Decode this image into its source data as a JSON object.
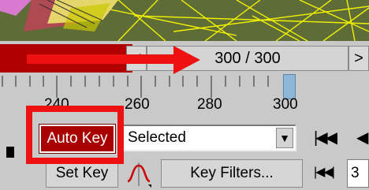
{
  "time_slider": {
    "prev_label": "<",
    "frame_display": "300 / 300",
    "next_label": ">"
  },
  "ruler": {
    "labels": [
      "240",
      "260",
      "280",
      "300"
    ]
  },
  "controls": {
    "auto_key_label": "Auto Key",
    "selection_value": "Selected",
    "dropdown_arrow": "▼",
    "goto_start_glyph": "|◀◀",
    "prev_frame_glyph": "◀",
    "set_key_label": "Set Key",
    "key_filters_label": "Key Filters...",
    "key_mode_glyph": "|◀◀|",
    "current_frame": "3"
  },
  "colors": {
    "auto_key_active": "#a80000",
    "highlight": "#ee1111",
    "viewport_bg": "#5c6a36"
  }
}
